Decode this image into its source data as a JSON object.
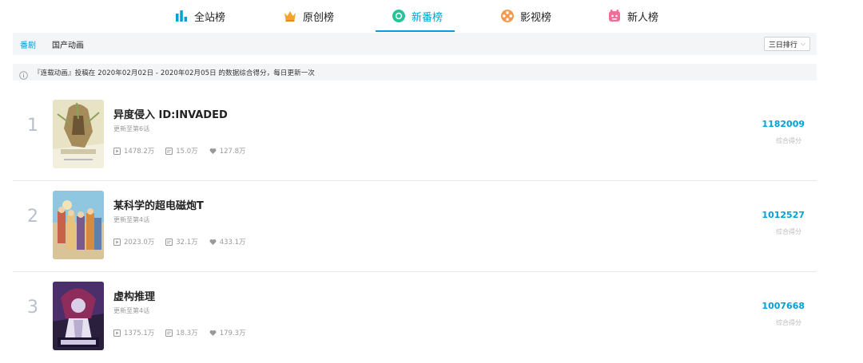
{
  "nav": {
    "tabs": [
      {
        "label": "全站榜",
        "icon": "bar-chart-icon"
      },
      {
        "label": "原创榜",
        "icon": "crown-icon"
      },
      {
        "label": "新番榜",
        "icon": "new-anime-icon",
        "active": true
      },
      {
        "label": "影视榜",
        "icon": "film-reel-icon"
      },
      {
        "label": "新人榜",
        "icon": "newcomer-icon"
      }
    ]
  },
  "subbar": {
    "tabs": [
      {
        "label": "番剧",
        "active": true
      },
      {
        "label": "国产动画"
      }
    ],
    "sort_label": "三日排行"
  },
  "notice": {
    "text": "『连载动画』投稿在 2020年02月02日 - 2020年02月05日 的数据综合得分，每日更新一次"
  },
  "ranking": [
    {
      "rank": "1",
      "title": "异度侵入 ID:INVADED",
      "update": "更新至第6话",
      "plays": "1478.2万",
      "danmaku": "15.0万",
      "likes": "127.8万",
      "score": "1182009",
      "score_label": "综合得分"
    },
    {
      "rank": "2",
      "title": "某科学的超电磁炮T",
      "update": "更新至第4话",
      "plays": "2023.0万",
      "danmaku": "32.1万",
      "likes": "433.1万",
      "score": "1012527",
      "score_label": "综合得分"
    },
    {
      "rank": "3",
      "title": "虚构推理",
      "update": "更新至第4话",
      "plays": "1375.1万",
      "danmaku": "18.3万",
      "likes": "179.3万",
      "score": "1007668",
      "score_label": "综合得分"
    }
  ],
  "colors": {
    "accent": "#00a1d6",
    "muted": "#999999",
    "rank": "#b8c0cc"
  }
}
